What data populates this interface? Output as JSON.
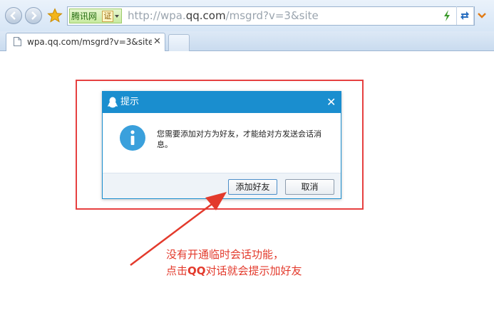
{
  "browser": {
    "address": {
      "site_name": "腾讯网",
      "cert_label": "证",
      "url_prefix": "http://wpa.",
      "url_domain": "qq.com",
      "url_suffix": "/msgrd?v=3&site"
    },
    "tab": {
      "title": "wpa.qq.com/msgrd?v=3&site",
      "close": "✕"
    }
  },
  "dialog": {
    "title": "提示",
    "close": "✕",
    "message": "您需要添加对方为好友，才能给对方发送会话消息。",
    "add_button": "添加好友",
    "cancel_button": "取消"
  },
  "annotation": {
    "line1": "没有开通临时会话功能，",
    "line2_prefix": "点击",
    "line2_bold": "QQ",
    "line2_suffix": "对话就会提示加好友"
  },
  "colors": {
    "accent": "#1a8ecf",
    "highlight": "#e64040",
    "annotation": "#e33a2c"
  },
  "icons": [
    "back-icon",
    "forward-icon",
    "favorites-star-icon",
    "certificate-icon",
    "compat-bolt-icon",
    "refresh-icon",
    "dropdown-icon",
    "document-icon",
    "qq-penguin-icon",
    "info-icon"
  ]
}
